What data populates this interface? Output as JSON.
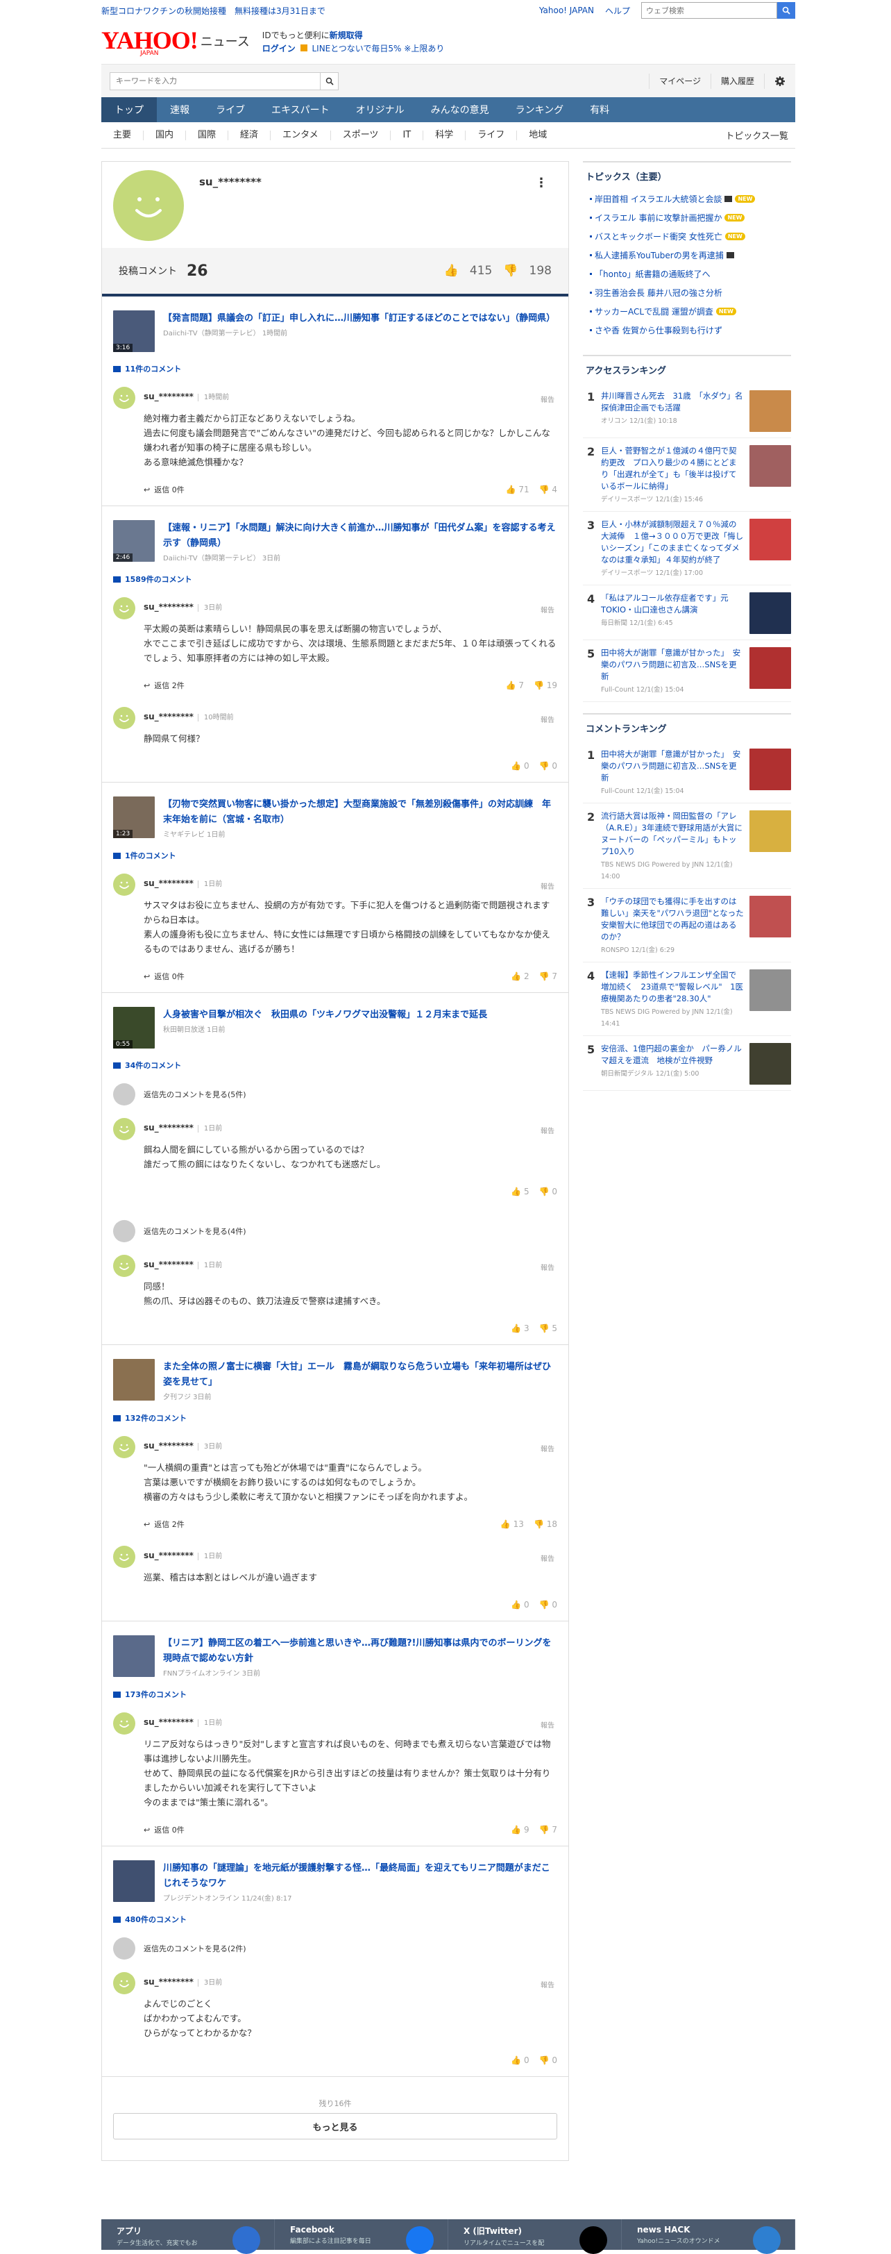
{
  "topstrip": {
    "message": "新型コロナワクチンの秋開始接種　無料接種は3月31日まで",
    "links": [
      "Yahoo! JAPAN",
      "ヘルプ"
    ],
    "search_placeholder": "ウェブ検索"
  },
  "header": {
    "logo_text": "YAHOO!",
    "logo_sub": "JAPAN",
    "logo_service": "ニュース",
    "promo_line1": "IDでもっと便利に",
    "promo_line1_strong": "新規取得",
    "promo_line2_login": "ログイン",
    "promo_line2_rest": "LINEとつないで毎日5% ※上限あり"
  },
  "search": {
    "placeholder": "キーワードを入力",
    "links": [
      "マイページ",
      "購入履歴"
    ]
  },
  "nav": {
    "tabs": [
      "トップ",
      "速報",
      "ライブ",
      "エキスパート",
      "オリジナル",
      "みんなの意見",
      "ランキング",
      "有料"
    ],
    "active": "トップ"
  },
  "subnav": {
    "items": [
      "主要",
      "国内",
      "国際",
      "経済",
      "エンタメ",
      "スポーツ",
      "IT",
      "科学",
      "ライフ",
      "地域"
    ],
    "all": "トピックス一覧"
  },
  "profile": {
    "username": "su_********",
    "comments_label": "投稿コメント",
    "comments_count": "26",
    "likes": "415",
    "dislikes": "198"
  },
  "articles": [
    {
      "title": "【発言問題】県議会の「訂正」申し入れに…川勝知事「訂正するほどのことではない」（静岡県）",
      "source": "Daiichi-TV（静岡第一テレビ）  1時間前",
      "duration": "3:16",
      "comment_count": "11件のコメント",
      "comments": [
        {
          "name": "su_********",
          "time": "1時間前",
          "text": "絶対権力者主義だから訂正などありえないでしょうね。\n過去に何度も議会問題発言で\"ごめんなさい\"の連発だけど、今回も認められると同じかな？しかしこんな嫌われ者が知事の椅子に居座る県も珍しい。\nある意味絶滅危惧種かな？",
          "replies": "返信  0件",
          "up": "71",
          "down": "4"
        }
      ]
    },
    {
      "title": "【速報・リニア】「水問題」解決に向け大きく前進か…川勝知事が「田代ダム案」を容認する考え示す（静岡県）",
      "source": "Daiichi-TV（静岡第一テレビ）  3日前",
      "duration": "2:46",
      "comment_count": "1589件のコメント",
      "comments": [
        {
          "name": "su_********",
          "time": "3日前",
          "text": "平太殿の英断は素晴らしい！静岡県民の事を思えば断腸の物言いでしょうが、\n水でここまで引き延ばしに成功ですから、次は環境、生態系問題とまだまだ5年、１０年は頑張ってくれるでしょう、知事原拝者の方には神の如し平太殿。",
          "replies": "返信  2件",
          "up": "7",
          "down": "19"
        },
        {
          "name": "su_********",
          "time": "10時間前",
          "text": "静岡県て何様？",
          "replies": "",
          "up": "0",
          "down": "0"
        }
      ]
    },
    {
      "title": "【刃物で突然買い物客に襲い掛かった想定】大型商業施設で「無差別殺傷事件」の対応訓練　年末年始を前に（宮城・名取市）",
      "source": "ミヤギテレビ  1日前",
      "duration": "1:23",
      "comment_count": "1件のコメント",
      "comments": [
        {
          "name": "su_********",
          "time": "1日前",
          "text": "サスマタはお役に立ちません、投網の方が有効です。下手に犯人を傷つけると過剰防衛で問題視されますからね日本は。\n素人の護身術も役に立ちません、特に女性には無理です日頃から格闘技の訓練をしていてもなかなか使えるものではありません、逃げるが勝ち！",
          "replies": "返信  0件",
          "up": "2",
          "down": "7"
        }
      ]
    },
    {
      "title": "人身被害や目撃が相次ぐ　秋田県の「ツキノワグマ出没警報」１２月末まで延長",
      "source": "秋田朝日放送  1日前",
      "duration": "0:55",
      "comment_count": "34件のコメント",
      "comments": [
        {
          "parent": "返信先のコメントを見る(5件)",
          "name": "su_********",
          "time": "1日前",
          "text": "餌ね人間を餌にしている熊がいるから困っているのでは？\n誰だって熊の餌にはなりたくないし、なつかれても迷惑だし。",
          "replies": "",
          "up": "5",
          "down": "0"
        },
        {
          "parent": "返信先のコメントを見る(4件)",
          "name": "su_********",
          "time": "1日前",
          "text": "同感！\n熊の爪、牙は凶器そのもの、鉄刀法違反で警察は逮捕すべき。",
          "replies": "",
          "up": "3",
          "down": "5"
        }
      ]
    },
    {
      "title": "また全体の照ノ富士に横審「大甘」エール　霧島が綱取りなら危うい立場も「来年初場所はぜひ姿を見せて」",
      "source": "夕刊フジ  3日前",
      "duration": "",
      "comment_count": "132件のコメント",
      "comments": [
        {
          "name": "su_********",
          "time": "3日前",
          "text": "\"一人横綱の重責\"とは言っても殆どが休場では\"重責\"にならんでしょう。\n言葉は悪いですが横綱をお飾り扱いにするのは如何なものでしょうか。\n横審の方々はもう少し柔軟に考えて頂かないと相撲ファンにそっぽを向かれますよ。",
          "replies": "返信  2件",
          "up": "13",
          "down": "18"
        },
        {
          "name": "su_********",
          "time": "1日前",
          "text": "巡業、稽古は本割とはレベルが違い過ぎます",
          "replies": "",
          "up": "0",
          "down": "0"
        }
      ]
    },
    {
      "title": "【リニア】静岡工区の着工へ一歩前進と思いきや…再び難題?!川勝知事は県内でのボーリングを現時点で認めない方針",
      "source": "FNNプライムオンライン  3日前",
      "duration": "",
      "comment_count": "173件のコメント",
      "comments": [
        {
          "name": "su_********",
          "time": "1日前",
          "text": "リニア反対ならはっきり\"反対\"しますと宣言すれば良いものを、何時までも煮え切らない言葉遊びでは物事は進捗しないよ川勝先生。\nせめて、静岡県民の益になる代償案をJRから引き出すほどの技量は有りませんか？策士気取りは十分有りましたからいい加減それを実行して下さいよ\n今のままでは\"策士策に溺れる\"。",
          "replies": "返信  0件",
          "up": "9",
          "down": "7"
        }
      ]
    },
    {
      "title": "川勝知事の「謎理論」を地元紙が援護射撃する怪…「最終局面」を迎えてもリニア問題がまだこじれそうなワケ",
      "source": "プレジデントオンライン  11/24(金) 8:17",
      "duration": "",
      "comment_count": "480件のコメント",
      "comments": [
        {
          "parent": "返信先のコメントを見る(2件)",
          "name": "su_********",
          "time": "3日前",
          "text": "よんでじのごとく\nばかわかってよむんです。\nひらがなってとわかるかな？",
          "replies": "",
          "up": "0",
          "down": "0"
        }
      ]
    }
  ],
  "more": {
    "rest": "残り16件",
    "button": "もっと見る"
  },
  "labels": {
    "report": "報告"
  },
  "sidebar": {
    "topics_title": "トピックス（主要）",
    "topics": [
      {
        "text": "岸田首相 イスラエル大統領と会談",
        "badge": "video+new"
      },
      {
        "text": "イスラエル 事前に攻撃計画把握か",
        "badge": "new"
      },
      {
        "text": "バスとキックボード衝突 女性死亡",
        "badge": "new"
      },
      {
        "text": "私人逮捕系YouTuberの男を再逮捕",
        "badge": "video"
      },
      {
        "text": "「honto」紙書籍の通販終了へ",
        "badge": ""
      },
      {
        "text": "羽生善治会長 藤井八冠の強さ分析",
        "badge": ""
      },
      {
        "text": "サッカーACLで乱闘 運盟が調査",
        "badge": "new"
      },
      {
        "text": "さや香 佐賀から仕事殺到も行けず",
        "badge": ""
      }
    ],
    "access_title": "アクセスランキング",
    "access": [
      {
        "n": "1",
        "text": "井川暉晋さん死去　31歳　「水ダウ」名探偵津田企画でも活躍",
        "src": "オリコン 12/1(金) 10:18",
        "color": "#c98a4a"
      },
      {
        "n": "2",
        "text": "巨人・菅野智之が１億減の４億円で契約更改　プロ入り最少の４勝にとどまり「出遅れが全て」も「後半は投げているボールに納得」",
        "src": "デイリースポーツ 12/1(金) 15:46",
        "color": "#a06060"
      },
      {
        "n": "3",
        "text": "巨人・小林が減額制限超え７０％減の大減俸　１億→３０００万で更改「悔しいシーズン」「このまま亡くなってダメなのは重々承知」４年契約が終了",
        "src": "デイリースポーツ 12/1(金) 17:00",
        "color": "#d04040"
      },
      {
        "n": "4",
        "text": "「私はアルコール依存症者です」元TOKIO・山口達也さん講演",
        "src": "毎日新聞 12/1(金) 6:45",
        "color": "#203050"
      },
      {
        "n": "5",
        "text": "田中将大が謝罪「意識が甘かった」　安樂のパワハラ問題に初言及…SNSを更新",
        "src": "Full-Count 12/1(金) 15:04",
        "color": "#b03030"
      }
    ],
    "comment_title": "コメントランキング",
    "comment": [
      {
        "n": "1",
        "text": "田中将大が謝罪「意識が甘かった」　安樂のパワハラ問題に初言及…SNSを更新",
        "src": "Full-Count 12/1(金) 15:04",
        "color": "#b03030"
      },
      {
        "n": "2",
        "text": "流行語大賞は阪神・岡田監督の「アレ（A.R.E）」3年連続で野球用語が大賞に ヌートバーの「ペッパーミル」もトップ10入り",
        "src": "TBS NEWS DIG Powered by JNN 12/1(金) 14:00",
        "color": "#d8b040"
      },
      {
        "n": "3",
        "text": "「ウチの球団でも獲得に手を出すのは難しい」楽天を\"パワハラ退団\"となった安樂智大に他球団での再起の道はあるのか？",
        "src": "RONSPO 12/1(金) 6:29",
        "color": "#c05050"
      },
      {
        "n": "4",
        "text": "【速報】季節性インフルエンザ全国で増加続く　23道県で\"警報レベル\"　1医療機関あたりの患者\"28.30人\"",
        "src": "TBS NEWS DIG Powered by JNN 12/1(金) 14:41",
        "color": "#909090"
      },
      {
        "n": "5",
        "text": "安倍派、1億円超の裏金か　パー券ノルマ超えを還流　地検が立件視野",
        "src": "朝日新聞デジタル 12/1(金) 5:00",
        "color": "#404030"
      }
    ]
  },
  "footer": [
    {
      "title": "アプリ",
      "sub": "データ生活化で、充実でもお",
      "color": "#2f6fd0"
    },
    {
      "title": "Facebook",
      "sub": "編集部による注目記事を毎日",
      "color": "#1877f2"
    },
    {
      "title": "X (旧Twitter)",
      "sub": "リアルタイムでニュースを配",
      "color": "#000000"
    },
    {
      "title": "news HACK",
      "sub": "Yahoo!ニュースのオウンドメ",
      "color": "#2e7fd0"
    }
  ]
}
